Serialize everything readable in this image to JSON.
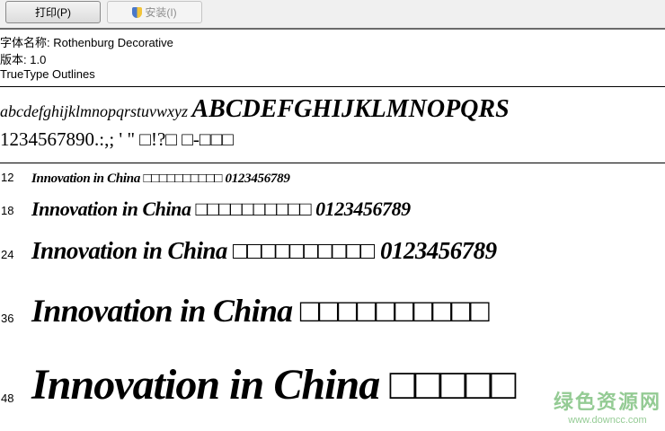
{
  "toolbar": {
    "print_label": "打印(P)",
    "install_label": "安装(I)"
  },
  "info": {
    "font_name": "字体名称: Rothenburg Decorative",
    "version": "版本: 1.0",
    "outline": "TrueType Outlines"
  },
  "charset": {
    "lower": "abcdefghijklmnopqrstuvwxyz",
    "upper": "ABCDEFGHIJKLMNOPQRS",
    "digits": "1234567890.:,; ' \" □!?□ □-□□□"
  },
  "samples": [
    {
      "size": "12",
      "text": "Innovation in China □□□□□□□□□□ 0123456789"
    },
    {
      "size": "18",
      "text": "Innovation in China □□□□□□□□□□ 0123456789"
    },
    {
      "size": "24",
      "text": "Innovation in China □□□□□□□□□□ 0123456789"
    },
    {
      "size": "36",
      "text": "Innovation in China □□□□□□□□□□"
    },
    {
      "size": "48",
      "text": "Innovation in China □□□□□"
    }
  ],
  "watermark": {
    "title": "绿色资源网",
    "url": "www.downcc.com"
  }
}
